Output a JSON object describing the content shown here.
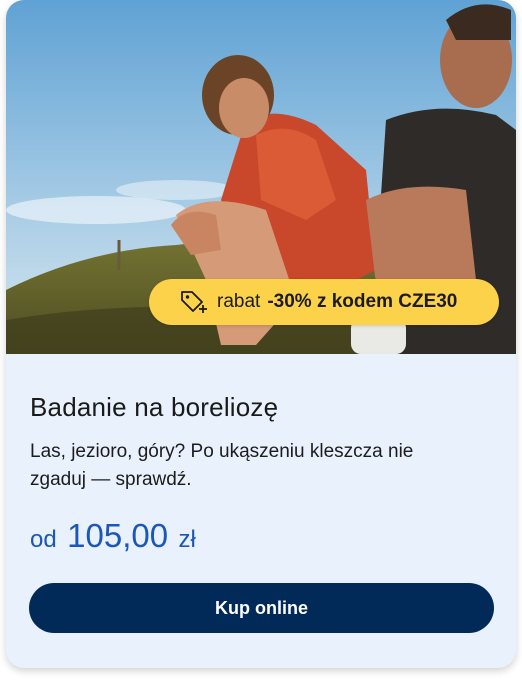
{
  "card": {
    "image_alt": "hikers resting on a grassy hill",
    "badge": {
      "icon": "tag-plus-icon",
      "prefix": "rabat",
      "code_text": "-30% z kodem CZE30",
      "color": "#fcd24a"
    },
    "title": "Badanie na boreliozę",
    "description": "Las, jezioro, góry? Po ukąszeniu kleszcza nie zgaduj — sprawdź.",
    "price": {
      "prefix": "od",
      "amount": "105,00",
      "currency": "zł",
      "color": "#1a57b8"
    },
    "button_label": "Kup online",
    "button_color": "#022a58",
    "background_color": "#e8f1fc"
  }
}
